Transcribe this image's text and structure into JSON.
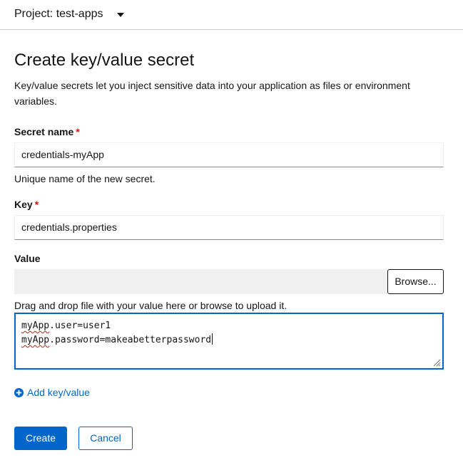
{
  "header": {
    "project_label": "Project: test-apps"
  },
  "form": {
    "title": "Create key/value secret",
    "description": "Key/value secrets let you inject sensitive data into your application as files or environment variables.",
    "required_marker": "*",
    "secret_name": {
      "label": "Secret name",
      "value": "credentials-myApp",
      "helper": "Unique name of the new secret."
    },
    "key": {
      "label": "Key",
      "value": "credentials.properties"
    },
    "value": {
      "label": "Value",
      "browse_label": "Browse...",
      "helper": "Drag and drop file with your value here or browse to upload it.",
      "line1_prefix": "myApp",
      "line1_rest": ".user=user1",
      "line2_prefix": "myApp",
      "line2_rest": ".password=makeabetterpassword"
    },
    "add_link": "Add key/value",
    "create_label": "Create",
    "cancel_label": "Cancel"
  },
  "colors": {
    "primary": "#0066cc",
    "required": "#c9190b",
    "border": "#d2d2d2"
  }
}
